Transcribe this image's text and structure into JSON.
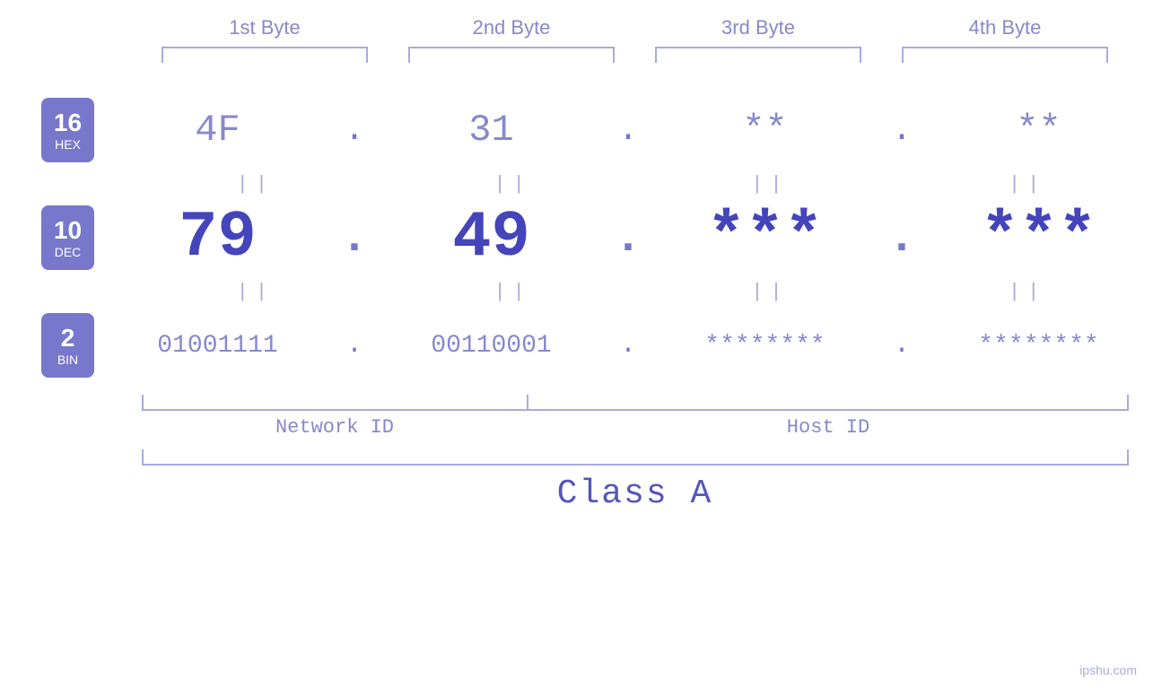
{
  "headers": {
    "byte1": "1st Byte",
    "byte2": "2nd Byte",
    "byte3": "3rd Byte",
    "byte4": "4th Byte"
  },
  "badges": {
    "hex": {
      "num": "16",
      "name": "HEX"
    },
    "dec": {
      "num": "10",
      "name": "DEC"
    },
    "bin": {
      "num": "2",
      "name": "BIN"
    }
  },
  "hex_values": {
    "b1": "4F",
    "b2": "31",
    "b3": "**",
    "b4": "**",
    "dot": "."
  },
  "dec_values": {
    "b1": "79",
    "b2": "49",
    "b3": "***",
    "b4": "***",
    "dot": "."
  },
  "bin_values": {
    "b1": "01001111",
    "b2": "00110001",
    "b3": "********",
    "b4": "********",
    "dot": "."
  },
  "labels": {
    "network_id": "Network ID",
    "host_id": "Host ID",
    "class": "Class A"
  },
  "watermark": "ipshu.com",
  "separator": "||"
}
